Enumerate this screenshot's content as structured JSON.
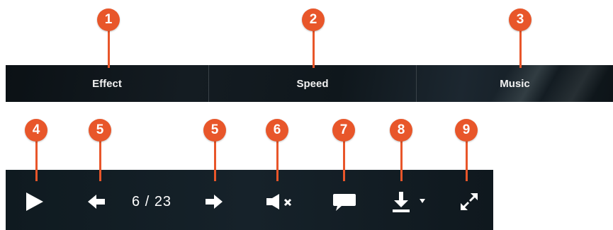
{
  "top_bar": {
    "effect_label": "Effect",
    "speed_label": "Speed",
    "music_label": "Music"
  },
  "callouts": [
    "1",
    "2",
    "3",
    "4",
    "5",
    "5",
    "6",
    "7",
    "8",
    "9"
  ],
  "player": {
    "play_icon": "play-icon",
    "prev_icon": "arrow-left-icon",
    "current_slide": "6",
    "separator": "/",
    "total_slides": "23",
    "next_icon": "arrow-right-icon",
    "mute_icon": "speaker-muted-icon",
    "comment_icon": "speech-bubble-icon",
    "download_icon": "download-icon",
    "dropdown_icon": "caret-down-icon",
    "fullscreen_icon": "expand-icon"
  },
  "colors": {
    "callout": "#e8562a",
    "bar_dark": "#0f1a20",
    "text": "#ffffff"
  }
}
